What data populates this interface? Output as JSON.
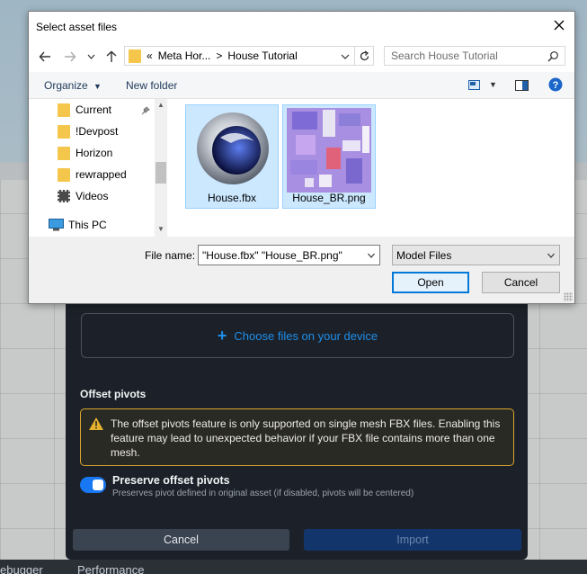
{
  "dialog": {
    "title": "Select asset files",
    "breadcrumb": [
      "«",
      "Meta Hor...",
      ">",
      "House Tutorial"
    ],
    "search_placeholder": "Search House Tutorial",
    "commands": {
      "organize": "Organize",
      "new_folder": "New folder"
    },
    "tree": [
      {
        "label": "Current",
        "icon": "folder-icon",
        "pinned": true
      },
      {
        "label": "!Devpost",
        "icon": "folder-icon"
      },
      {
        "label": "Horizon",
        "icon": "folder-icon"
      },
      {
        "label": "rewrapped",
        "icon": "folder-icon"
      },
      {
        "label": "Videos",
        "icon": "videos-folder-icon"
      },
      {
        "label": "This PC",
        "icon": "computer-icon"
      }
    ],
    "files": [
      {
        "name": "House.fbx",
        "icon": "cinema4d-icon",
        "selected": true
      },
      {
        "name": "House_BR.png",
        "icon": "texture-thumbnail",
        "selected": true
      }
    ],
    "file_name_label": "File name:",
    "file_name_value": "\"House.fbx\" \"House_BR.png\"",
    "file_type": "Model Files",
    "open_label": "Open",
    "cancel_label": "Cancel"
  },
  "panel": {
    "choose_files": "Choose files on your device",
    "offset_title": "Offset pivots",
    "warning": "The offset pivots feature is only supported on single mesh FBX files. Enabling this feature may lead to unexpected behavior if your FBX file contains more than one mesh.",
    "preserve_title": "Preserve offset pivots",
    "preserve_subtitle": "Preserves pivot defined in original asset (if disabled, pivots will be centered)",
    "preserve_enabled": true,
    "cancel_label": "Cancel",
    "import_label": "Import"
  },
  "bottom_tabs": [
    "ebugger",
    "Performance"
  ],
  "colors": {
    "accent": "#1877f2",
    "warning": "#d9a52b",
    "panel_bg": "#1c2129",
    "selection": "#cce8ff"
  }
}
